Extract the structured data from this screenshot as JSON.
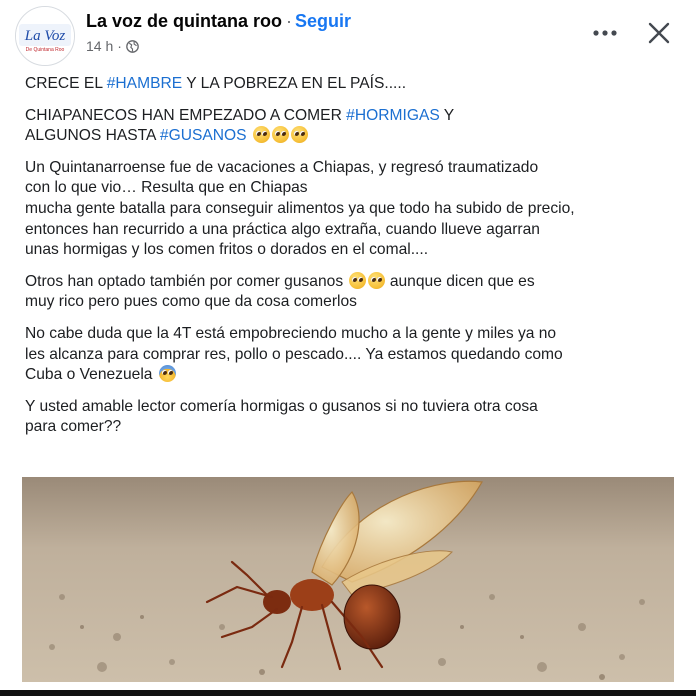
{
  "header": {
    "page_name": "La voz de quintana roo",
    "separator": "·",
    "follow_label": "Seguir",
    "time": "14 h",
    "time_separator": "·",
    "privacy_icon": "globe-icon",
    "avatar_logo": {
      "word": "La Voz",
      "subtitle": "De Quintana Roo"
    },
    "more_icon": "more-options-icon",
    "close_icon": "close-icon"
  },
  "post": {
    "p1": {
      "a": "CRECE EL ",
      "tag": "#HAMBRE",
      "b": " Y LA POBREZA EN EL PAÍS....."
    },
    "p2": {
      "l1a": "CHIAPANECOS HAN EMPEZADO A COMER ",
      "l1tag": "#HORMIGAS",
      "l1b": " Y",
      "l2a": "ALGUNOS HASTA ",
      "l2tag": "#GUSANOS",
      "emojis": [
        "pleading-face",
        "pleading-face",
        "pleading-face"
      ]
    },
    "p3": [
      "Un Quintanarroense fue de vacaciones a Chiapas, y regresó traumatizado",
      "con lo que vio… Resulta que en Chiapas",
      "mucha gente batalla para conseguir alimentos ya que todo ha subido de precio,",
      "entonces han recurrido a una práctica algo extraña, cuando llueve agarran",
      "unas hormigas y los comen fritos o dorados en el comal...."
    ],
    "p4": {
      "l1a": "Otros han optado también por comer gusanos",
      "l1b": "aunque dicen que es",
      "l2": "muy rico pero pues como que da cosa comerlos",
      "emojis": [
        "pleading-face",
        "pleading-face"
      ]
    },
    "p5": {
      "l1": "No cabe duda que la 4T está empobreciendo mucho a la gente y miles ya no",
      "l2": "les alcanza para comprar res, pollo o pescado.... Ya estamos quedando como",
      "l3": "Cuba o Venezuela",
      "emoji": "fearful-face"
    },
    "p6": [
      "Y usted amable lector comería hormigas o gusanos si no tuviera otra cosa",
      "para comer??"
    ]
  },
  "colors": {
    "link": "#1877f2",
    "hashtag": "#1b6fd1",
    "text": "#1c1e21",
    "muted": "#65676b"
  }
}
